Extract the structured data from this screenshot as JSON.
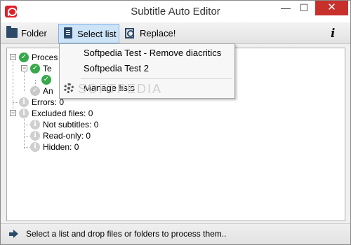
{
  "window": {
    "title": "Subtitle Auto Editor",
    "close_glyph": "✕",
    "min_glyph": "—",
    "max_glyph": "☐"
  },
  "toolbar": {
    "folder_label": "Folder",
    "select_label": "Select list",
    "replace_label": "Replace!",
    "info_glyph": "i"
  },
  "tree": {
    "processed_label": "Proces",
    "child1_label": "Te",
    "child3_label": "An",
    "errors_label": "Errors: 0",
    "excluded_label": "Excluded files: 0",
    "not_subtitles_label": "Not subtitles: 0",
    "read_only_label": "Read-only: 0",
    "hidden_label": "Hidden: 0"
  },
  "dropdown": {
    "items": [
      {
        "label": "Softpedia Test - Remove diacritics"
      },
      {
        "label": "Softpedia Test 2"
      }
    ],
    "manage_label": "Manage lists",
    "watermark": "SOFTPEDIA"
  },
  "status": {
    "text": "Select a list and drop files or folders to process them.."
  },
  "colors": {
    "accent": "#cde4f7",
    "close": "#c7302b",
    "success": "#37a84b"
  }
}
